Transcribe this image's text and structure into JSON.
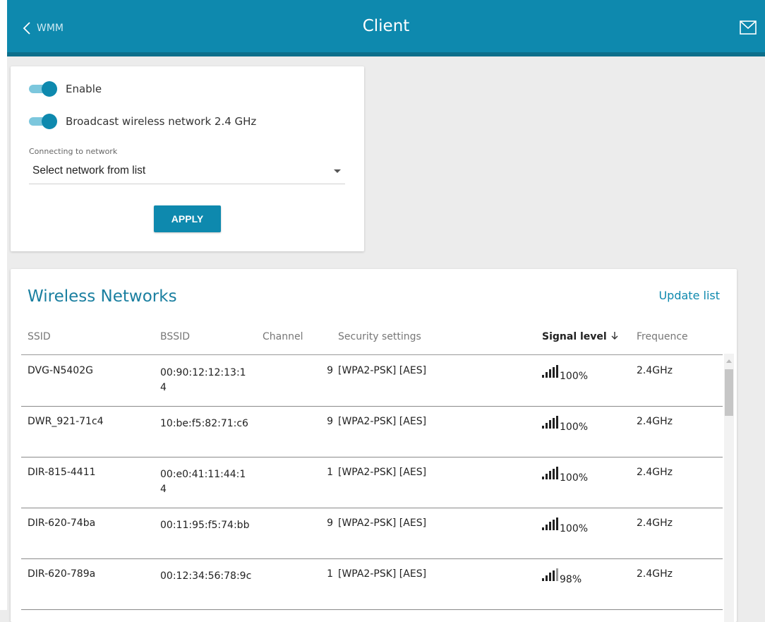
{
  "header": {
    "back_label": "WMM",
    "title": "Client"
  },
  "settings": {
    "enable_label": "Enable",
    "enable_on": true,
    "broadcast_label": "Broadcast wireless network 2.4 GHz",
    "broadcast_on": true,
    "network_field_label": "Connecting to network",
    "network_value": "Select network from list",
    "apply_label": "APPLY"
  },
  "networks": {
    "title": "Wireless Networks",
    "update_label": "Update list",
    "columns": {
      "ssid": "SSID",
      "bssid": "BSSID",
      "channel": "Channel",
      "security": "Security settings",
      "signal": "Signal level",
      "frequence": "Frequence"
    },
    "sort_indicator": "arrow-down-icon",
    "rows": [
      {
        "ssid": "DVG-N5402G",
        "bssid": "00:90:12:12:13:14",
        "channel": "9",
        "security": "[WPA2-PSK] [AES]",
        "signal": "100%",
        "frequence": "2.4GHz"
      },
      {
        "ssid": "DWR_921-71c4",
        "bssid": "10:be:f5:82:71:c6",
        "channel": "9",
        "security": "[WPA2-PSK] [AES]",
        "signal": "100%",
        "frequence": "2.4GHz"
      },
      {
        "ssid": "DIR-815-4411",
        "bssid": "00:e0:41:11:44:14",
        "channel": "1",
        "security": "[WPA2-PSK] [AES]",
        "signal": "100%",
        "frequence": "2.4GHz"
      },
      {
        "ssid": "DIR-620-74ba",
        "bssid": "00:11:95:f5:74:bb",
        "channel": "9",
        "security": "[WPA2-PSK] [AES]",
        "signal": "100%",
        "frequence": "2.4GHz"
      },
      {
        "ssid": "DIR-620-789a",
        "bssid": "00:12:34:56:78:9c",
        "channel": "1",
        "security": "[WPA2-PSK] [AES]",
        "signal": "98%",
        "frequence": "2.4GHz"
      }
    ]
  },
  "colors": {
    "accent": "#0e89ae",
    "background": "#ececec"
  }
}
